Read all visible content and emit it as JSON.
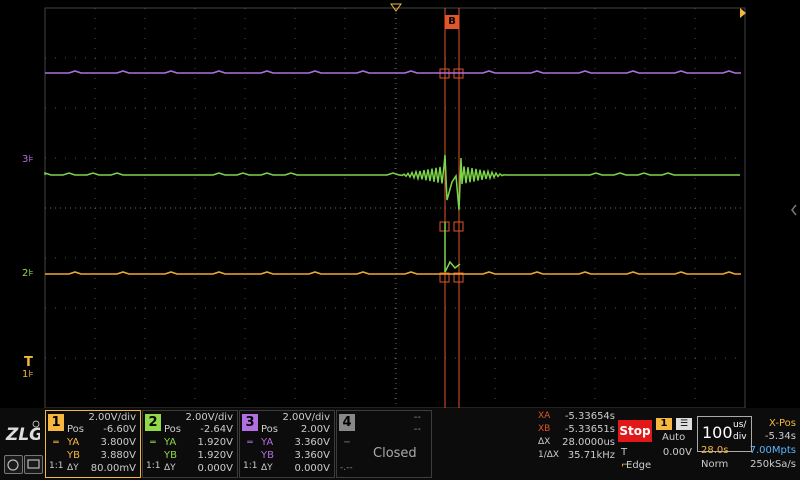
{
  "screen": {
    "cursor_b_label": "B",
    "trig_label": "T",
    "markers": [
      {
        "name": "channel-3-marker",
        "text": "3",
        "color": "#b06ee0"
      },
      {
        "name": "channel-2-marker",
        "text": "2",
        "color": "#8fd94a"
      },
      {
        "name": "channel-1-marker",
        "text": "1",
        "color": "#f5b740"
      }
    ],
    "colors": {
      "ch1": "#f0a830",
      "ch2": "#7cd64a",
      "ch3": "#b070e0",
      "cursor": "#e0552a",
      "grid": "#555555"
    }
  },
  "ch1": {
    "num": "1",
    "scale": "2.00V/div",
    "pos_label": "Pos",
    "pos": "-6.60V",
    "ya_label": "YA",
    "ya": "3.800V",
    "yb_label": "YB",
    "yb": "3.880V",
    "dy_label": "ΔY",
    "dy": "80.00mV",
    "coupling": "1:1",
    "color": "#f5b740"
  },
  "ch2": {
    "num": "2",
    "scale": "2.00V/div",
    "pos_label": "Pos",
    "pos": "-2.64V",
    "ya_label": "YA",
    "ya": "1.920V",
    "yb_label": "YB",
    "yb": "1.920V",
    "dy_label": "ΔY",
    "dy": "0.000V",
    "coupling": "1:1",
    "color": "#8fd94a"
  },
  "ch3": {
    "num": "3",
    "scale": "2.00V/div",
    "pos_label": "Pos",
    "pos": "2.00V",
    "ya_label": "YA",
    "ya": "3.360V",
    "yb_label": "YB",
    "yb": "3.360V",
    "dy_label": "ΔY",
    "dy": "0.000V",
    "coupling": "1:1",
    "color": "#b06ee0"
  },
  "ch4": {
    "num": "4",
    "scale": "--",
    "pos": "--",
    "status": "Closed",
    "sym": "-.--"
  },
  "cursors": {
    "xa_label": "XA",
    "xa": "-5.33654s",
    "xb_label": "XB",
    "xb": "-5.33651s",
    "dx_label": "ΔX",
    "dx": "28.0000us",
    "inv_label": "1/ΔX",
    "inv": "35.71kHz"
  },
  "run": {
    "state": "Stop",
    "trig_ch": "1",
    "mode": "Auto",
    "t_label": "T",
    "trig_level": "0.00V",
    "trig_type": "Edge"
  },
  "timebase": {
    "value": "100",
    "unit_top": "us/",
    "unit_bottom": "div",
    "xpos_label": "X-Pos",
    "xpos": "-5.34s",
    "record_time": "28.0s",
    "mem_depth": "7.00Mpts",
    "acq_mode": "Norm",
    "sample_rate": "250kSa/s"
  }
}
